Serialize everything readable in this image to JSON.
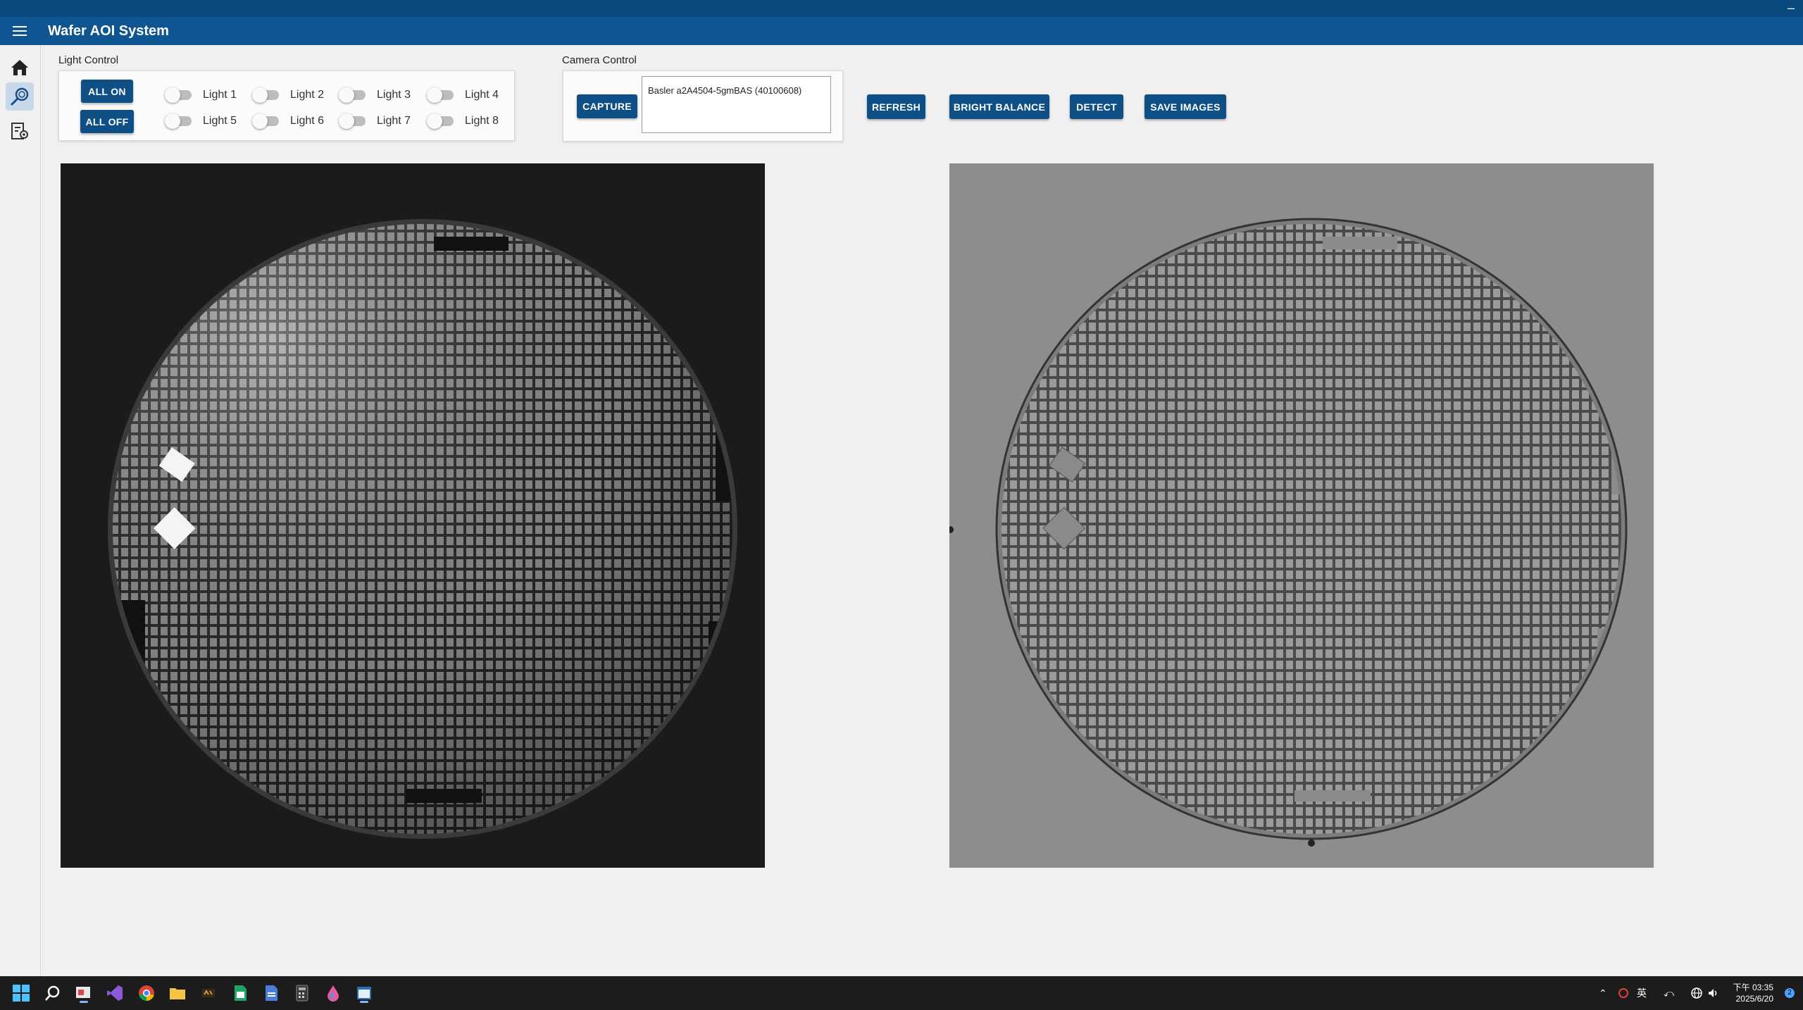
{
  "app": {
    "title": "Wafer AOI System"
  },
  "nav": [
    {
      "name": "home",
      "icon": "home-icon"
    },
    {
      "name": "inspect",
      "icon": "search-wafer-icon",
      "active": true
    },
    {
      "name": "settings",
      "icon": "settings-report-icon"
    }
  ],
  "light_control": {
    "label": "Light Control",
    "all_on": "ALL ON",
    "all_off": "ALL OFF",
    "lights": [
      {
        "label": "Light 1",
        "on": false
      },
      {
        "label": "Light 2",
        "on": false
      },
      {
        "label": "Light 3",
        "on": false
      },
      {
        "label": "Light 4",
        "on": false
      },
      {
        "label": "Light 5",
        "on": false
      },
      {
        "label": "Light 6",
        "on": false
      },
      {
        "label": "Light 7",
        "on": false
      },
      {
        "label": "Light 8",
        "on": false
      }
    ]
  },
  "camera_control": {
    "label": "Camera Control",
    "capture": "CAPTURE",
    "cameras": [
      "Basler a2A4504-5gmBAS (40100608)"
    ]
  },
  "toolbar": {
    "refresh": "REFRESH",
    "bright_balance": "BRIGHT BALANCE",
    "detect": "DETECT",
    "save_images": "SAVE IMAGES"
  },
  "images": {
    "raw": {
      "label": "raw wafer image"
    },
    "processed": {
      "label": "processed wafer image"
    }
  },
  "taskbar": {
    "apps": [
      "start-icon",
      "search-icon",
      "task-app-icon",
      "visual-studio-icon",
      "chrome-icon",
      "file-explorer-icon",
      "app-icon",
      "spreadsheet-icon",
      "document-icon",
      "calculator-icon",
      "paint-icon",
      "window-app-icon"
    ],
    "ime": "英",
    "time": "下午 03:35",
    "date": "2025/6/20",
    "notifications": "2"
  },
  "colors": {
    "accent": "#0e4f86",
    "titlebar": "#0e5591",
    "taskbar": "#1c1c1c"
  }
}
